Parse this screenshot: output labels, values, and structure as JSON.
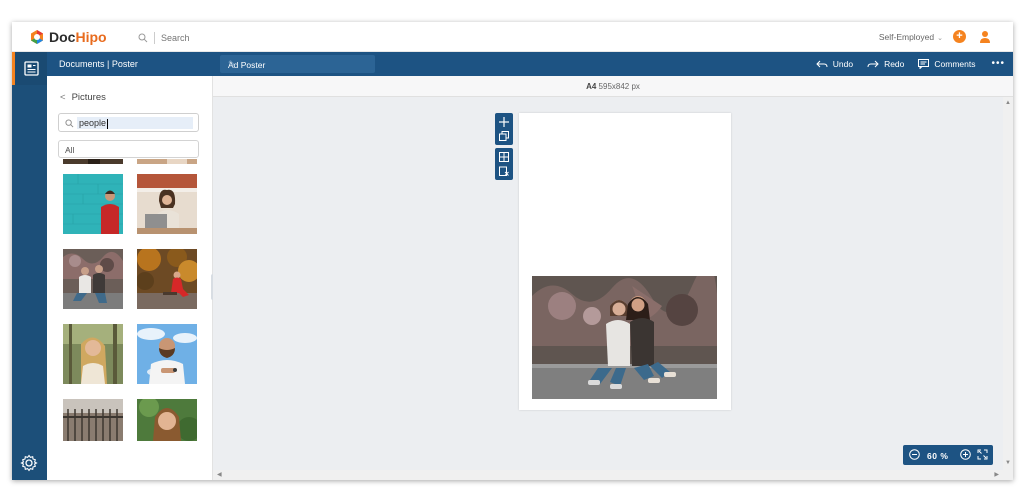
{
  "brand": {
    "name_part1": "Doc",
    "name_part2": "Hipo"
  },
  "topbar": {
    "search_placeholder": "Search",
    "account_label": "Self-Employed",
    "add_label": "+"
  },
  "header": {
    "breadcrumb": "Documents | Poster",
    "document_name": "Ad Poster",
    "undo_label": "Undo",
    "redo_label": "Redo",
    "comments_label": "Comments",
    "more_label": "•••"
  },
  "panel": {
    "back_label": "Pictures",
    "search_value": "people",
    "filter_selected": "All",
    "thumbnails": [
      {
        "subject": "man-against-teal-wall"
      },
      {
        "subject": "woman-with-laptop-cafe"
      },
      {
        "subject": "friends-sitting-graffiti"
      },
      {
        "subject": "woman-in-red-autumn"
      },
      {
        "subject": "woman-smiling-trees"
      },
      {
        "subject": "man-smiling-sky"
      },
      {
        "subject": "street-railings"
      },
      {
        "subject": "woman-smiling-portrait"
      }
    ]
  },
  "canvas": {
    "size_format": "A4",
    "size_dims": "595x842 px",
    "zoom_value": "60",
    "zoom_unit": "%"
  },
  "colors": {
    "brand_blue": "#1d5383",
    "accent_orange": "#f5831f",
    "rail_blue": "#1c4f79"
  }
}
